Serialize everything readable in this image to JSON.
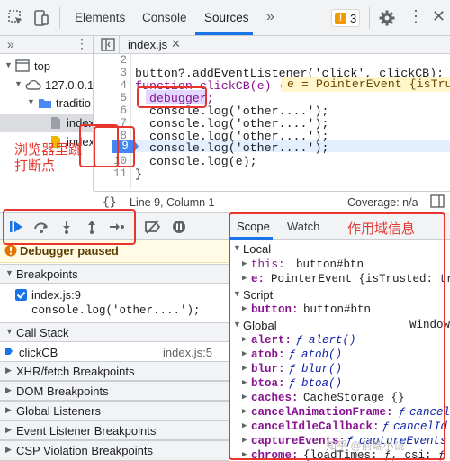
{
  "toolbar": {
    "tabs": [
      "Elements",
      "Console",
      "Sources"
    ],
    "active_tab": "Sources",
    "warning_count": "3"
  },
  "navigator": {
    "items": [
      {
        "label": "top"
      },
      {
        "label": "127.0.0.1"
      },
      {
        "label": "traditio"
      },
      {
        "label": "index"
      },
      {
        "label": "index"
      }
    ]
  },
  "editor": {
    "file_tab": "index.js",
    "lines": [
      {
        "num": "2",
        "text": ""
      },
      {
        "num": "3",
        "text": "button?.addEventListener('click', clickCB);"
      },
      {
        "num": "4",
        "text": "function clickCB(e) {"
      },
      {
        "num": "5",
        "text": "  debugger;"
      },
      {
        "num": "6",
        "text": "  console.log('other....');"
      },
      {
        "num": "7",
        "text": "  console.log('other....');"
      },
      {
        "num": "8",
        "text": "  console.log('other....');"
      },
      {
        "num": "9",
        "text": "  console.log('other....');"
      },
      {
        "num": "10",
        "text": "  console.log(e);"
      },
      {
        "num": "11",
        "text": "}"
      }
    ],
    "inline_value": "e = PointerEvent {isTrust",
    "paused_line_num": "9",
    "status_position": "Line 9, Column 1",
    "status_coverage": "Coverage: n/a",
    "status_braces": "{}"
  },
  "debugger": {
    "paused_text": "Debugger paused",
    "breakpoints_label": "Breakpoints",
    "breakpoint_file": "index.js:9",
    "breakpoint_code": "console.log('other....');",
    "breakpoint_checked": true,
    "callstack_label": "Call Stack",
    "callstack_fn": "clickCB",
    "callstack_loc": "index.js:5",
    "sections": [
      "XHR/fetch Breakpoints",
      "DOM Breakpoints",
      "Global Listeners",
      "Event Listener Breakpoints",
      "CSP Violation Breakpoints"
    ]
  },
  "scope": {
    "tabs": [
      "Scope",
      "Watch"
    ],
    "local_label": "Local",
    "local_this_key": "this:",
    "local_this_val": "button#btn",
    "local_e_key": "e:",
    "local_e_val": "PointerEvent {isTrusted: tr",
    "script_label": "Script",
    "script_button_key": "button:",
    "script_button_val": "button#btn",
    "global_label": "Global",
    "global_right": "Window",
    "globals": [
      {
        "key": "alert:",
        "f": "ƒ",
        "val": "alert()"
      },
      {
        "key": "atob:",
        "f": "ƒ",
        "val": "atob()"
      },
      {
        "key": "blur:",
        "f": "ƒ",
        "val": "blur()"
      },
      {
        "key": "btoa:",
        "f": "ƒ",
        "val": "btoa()"
      },
      {
        "key": "caches:",
        "f": "",
        "val": "CacheStorage {}"
      },
      {
        "key": "cancelAnimationFrame:",
        "f": "ƒ",
        "val": "cancel"
      },
      {
        "key": "cancelIdleCallback:",
        "f": "ƒ",
        "val": "cancelId"
      },
      {
        "key": "captureEvents:",
        "f": "ƒ",
        "val": "captureEvents"
      },
      {
        "key": "chrome:",
        "f": "",
        "val": "{loadTimes: ƒ, csi: ƒ"
      }
    ]
  },
  "annotations": {
    "nav_note_line1": "浏览器里跳",
    "nav_note_line2": "打断点",
    "scope_note": "作用域信息",
    "watermark": "知乎 @前端小饶"
  },
  "colors": {
    "accent": "#1a73e8",
    "annotation_red": "#e8362f",
    "paused_banner": "#fffbe5",
    "breakpoint_blue": "#4285f4"
  }
}
